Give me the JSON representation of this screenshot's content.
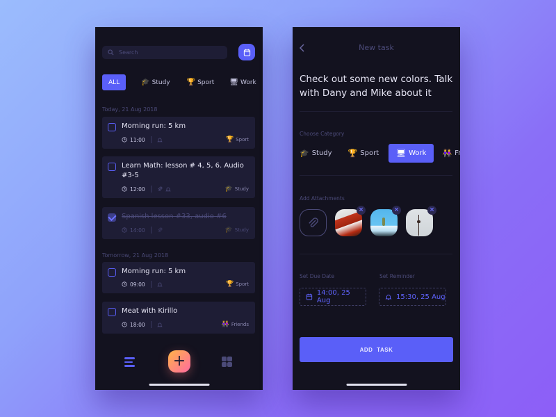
{
  "list_screen": {
    "search": {
      "placeholder": "Search",
      "value": ""
    },
    "calendar_button": "calendar-icon",
    "filters": [
      {
        "label": "ALL",
        "icon": "",
        "active": true
      },
      {
        "label": "Study",
        "icon": "🎓",
        "active": false
      },
      {
        "label": "Sport",
        "icon": "🏆",
        "active": false
      },
      {
        "label": "Work",
        "icon": "🖥",
        "active": false
      }
    ],
    "groups": [
      {
        "date": "Today, 21 Aug 2018",
        "tasks": [
          {
            "title": "Morning run: 5 km",
            "time": "11:00",
            "done": false,
            "attachment": false,
            "reminder": true,
            "category": "Sport",
            "category_icon": "🏆"
          },
          {
            "title": "Learn Math: lesson # 4, 5, 6. Audio #3-5",
            "time": "12:00",
            "done": false,
            "attachment": true,
            "reminder": true,
            "category": "Study",
            "category_icon": "🎓"
          },
          {
            "title": "Spanish lesson #33, audio #6",
            "time": "14:00",
            "done": true,
            "attachment": true,
            "reminder": false,
            "category": "Study",
            "category_icon": "🎓"
          }
        ]
      },
      {
        "date": "Tomorrow, 21 Aug 2018",
        "tasks": [
          {
            "title": "Morning run: 5 km",
            "time": "09:00",
            "done": false,
            "attachment": false,
            "reminder": true,
            "category": "Sport",
            "category_icon": "🏆"
          },
          {
            "title": "Meat with Kirillo",
            "time": "18:00",
            "done": false,
            "attachment": false,
            "reminder": true,
            "category": "Friends",
            "category_icon": "👭"
          }
        ]
      }
    ],
    "add_button": "+"
  },
  "new_task_screen": {
    "title": "New task",
    "description": "Check out some new colors. Talk with Dany and Mike about it",
    "category_label": "Choose Category",
    "categories": [
      {
        "label": "Study",
        "icon": "🎓",
        "active": false
      },
      {
        "label": "Sport",
        "icon": "🏆",
        "active": false
      },
      {
        "label": "Work",
        "icon": "🖥",
        "active": true
      },
      {
        "label": "Friends",
        "icon": "👭",
        "active": false
      }
    ],
    "attachments_label": "Add Attachments",
    "attachments": [
      {
        "name": "bridge-photo",
        "remove": "×"
      },
      {
        "name": "plant-photo",
        "remove": "×"
      },
      {
        "name": "tower-photo",
        "remove": "×"
      }
    ],
    "due_date_label": "Set Due Date",
    "due_date_value": "14:00, 25 Aug",
    "reminder_label": "Set Reminder",
    "reminder_value": "15:30, 25 Aug",
    "add_task_label": "ADD TASK"
  },
  "colors": {
    "accent": "#5a5ff8",
    "panel": "#13121f",
    "card": "#1e1d35",
    "muted": "#4b4a78"
  }
}
